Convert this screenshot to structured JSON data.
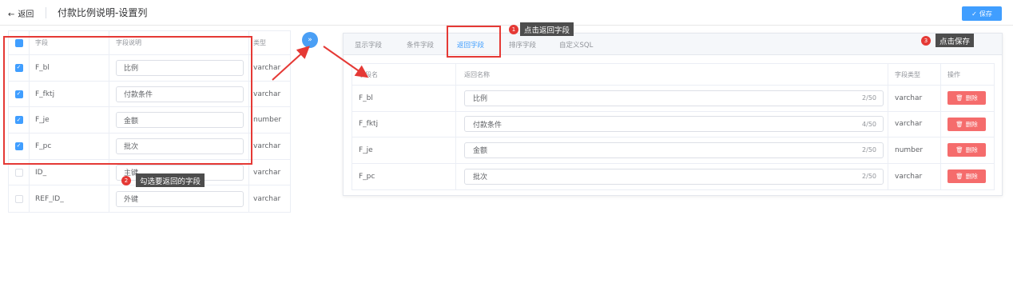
{
  "header": {
    "back_label": "返回",
    "back_arrow": "←",
    "title": "付款比例说明-设置列",
    "save_label": "保存",
    "save_icon": "✓"
  },
  "left_table": {
    "columns": [
      "字段",
      "字段说明",
      "类型"
    ],
    "rows": [
      {
        "field": "F_bl",
        "desc": "比例",
        "type": "varchar",
        "checked": true
      },
      {
        "field": "F_fktj",
        "desc": "付款条件",
        "type": "varchar",
        "checked": true
      },
      {
        "field": "F_je",
        "desc": "金额",
        "type": "number",
        "checked": true
      },
      {
        "field": "F_pc",
        "desc": "批次",
        "type": "varchar",
        "checked": true
      },
      {
        "field": "ID_",
        "desc": "主键",
        "type": "varchar",
        "checked": false
      },
      {
        "field": "REF_ID_",
        "desc": "外键",
        "type": "varchar",
        "checked": false
      }
    ]
  },
  "move_button_icon": "»",
  "tabs": [
    {
      "label": "显示字段",
      "active": false
    },
    {
      "label": "条件字段",
      "active": false
    },
    {
      "label": "返回字段",
      "active": true
    },
    {
      "label": "排序字段",
      "active": false
    },
    {
      "label": "自定义SQL",
      "active": false
    }
  ],
  "right_table": {
    "columns": [
      "字段名",
      "返回名称",
      "字段类型",
      "操作"
    ],
    "rows": [
      {
        "field": "F_bl",
        "name": "比例",
        "counter": "2/50",
        "type": "varchar"
      },
      {
        "field": "F_fktj",
        "name": "付款条件",
        "counter": "4/50",
        "type": "varchar"
      },
      {
        "field": "F_je",
        "name": "金额",
        "counter": "2/50",
        "type": "number"
      },
      {
        "field": "F_pc",
        "name": "批次",
        "counter": "2/50",
        "type": "varchar"
      }
    ],
    "delete_label": "删除",
    "delete_icon": "🗑"
  },
  "annotations": {
    "badge_1": "1",
    "tip_1": "点击返回字段",
    "badge_2": "2",
    "tip_2": "勾选要返回的字段",
    "badge_3": "3",
    "tip_3": "点击保存"
  },
  "colors": {
    "accent": "#409eff",
    "danger": "#f56c6c",
    "annotation_red": "#e53935"
  }
}
